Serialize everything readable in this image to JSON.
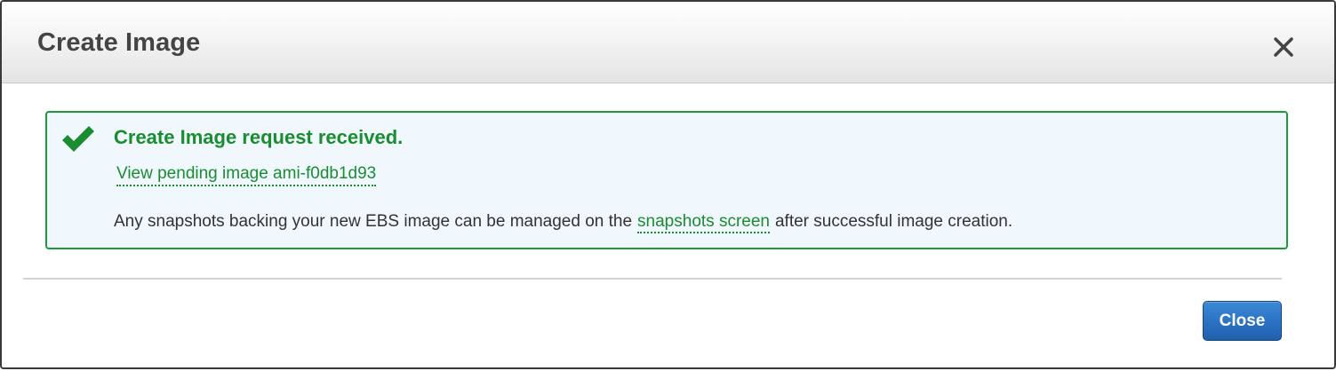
{
  "dialog": {
    "title": "Create Image",
    "close_icon": "close-icon",
    "close_button_label": "Close"
  },
  "alert": {
    "icon": "checkmark-icon",
    "title": "Create Image request received.",
    "pending_link": "View pending image ami-f0db1d93",
    "text_before": "Any snapshots backing your new EBS image can be managed on the",
    "snapshots_link": "snapshots screen",
    "text_after": "after successful image creation."
  },
  "colors": {
    "success_green": "#1a8d31",
    "alert_background": "#f0f7fd",
    "primary_button": "#2b71c2",
    "title_text": "#444444"
  }
}
